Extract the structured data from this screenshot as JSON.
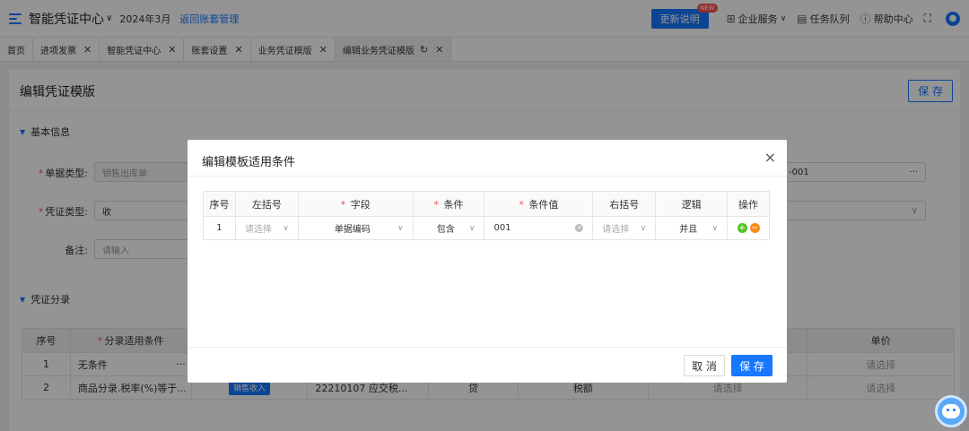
{
  "header": {
    "title": "智能凭证中心",
    "title_caret": "∨",
    "period": "2024年3月",
    "back_link": "返回账套管理",
    "update_button": "更新说明",
    "new_badge": "NEW",
    "enterprise_services": "企业服务",
    "enterprise_caret": "∨",
    "task_queue": "任务队列",
    "help_center": "帮助中心"
  },
  "tabs": [
    {
      "label": "首页"
    },
    {
      "label": "进项发票"
    },
    {
      "label": "智能凭证中心"
    },
    {
      "label": "账套设置"
    },
    {
      "label": "业务凭证模版"
    },
    {
      "label": "编辑业务凭证模版"
    }
  ],
  "page": {
    "title": "编辑凭证模版",
    "save_button": "保 存",
    "basic_info_section": "基本信息",
    "doc_type_label": "单据类型:",
    "doc_type_value": "销售出库单",
    "voucher_type_label": "凭证类型:",
    "voucher_type_value": "收",
    "remark_label": "备注:",
    "remark_placeholder": "请输入",
    "right_field_value": "-001",
    "right_field_more": "···",
    "entries_section": "凭证分录",
    "entries_headers": {
      "index": "序号",
      "condition": "分录适用条件",
      "unit_price": "单价"
    },
    "entries_rows": [
      {
        "index": "1",
        "condition": "无条件",
        "more": "···",
        "unit_price": "请选择"
      },
      {
        "index": "2",
        "condition": "商品分录.税率(%)等于...",
        "tag": "销售收入",
        "account": "22210107 应交税...",
        "direction": "贷",
        "amount": "税额",
        "mid_select": "请选择",
        "unit_price": "请选择"
      }
    ]
  },
  "modal": {
    "title": "编辑模板适用条件",
    "close": "×",
    "headers": {
      "index": "序号",
      "left_paren": "左括号",
      "field": "字段",
      "condition": "条件",
      "condition_value": "条件值",
      "right_paren": "右括号",
      "logic": "逻辑",
      "action": "操作"
    },
    "rows": [
      {
        "index": "1",
        "left_paren": "请选择",
        "field": "单据编码",
        "condition": "包含",
        "condition_value": "001",
        "right_paren": "请选择",
        "logic": "并且"
      }
    ],
    "cancel_button": "取 消",
    "save_button": "保 存"
  },
  "icons": {
    "add": "+",
    "remove": "−",
    "clear": "×",
    "chevron": "∨"
  },
  "colors": {
    "primary": "#1677ff",
    "add": "#52c41a",
    "remove": "#fa8c16",
    "required": "#ff4d4f"
  }
}
